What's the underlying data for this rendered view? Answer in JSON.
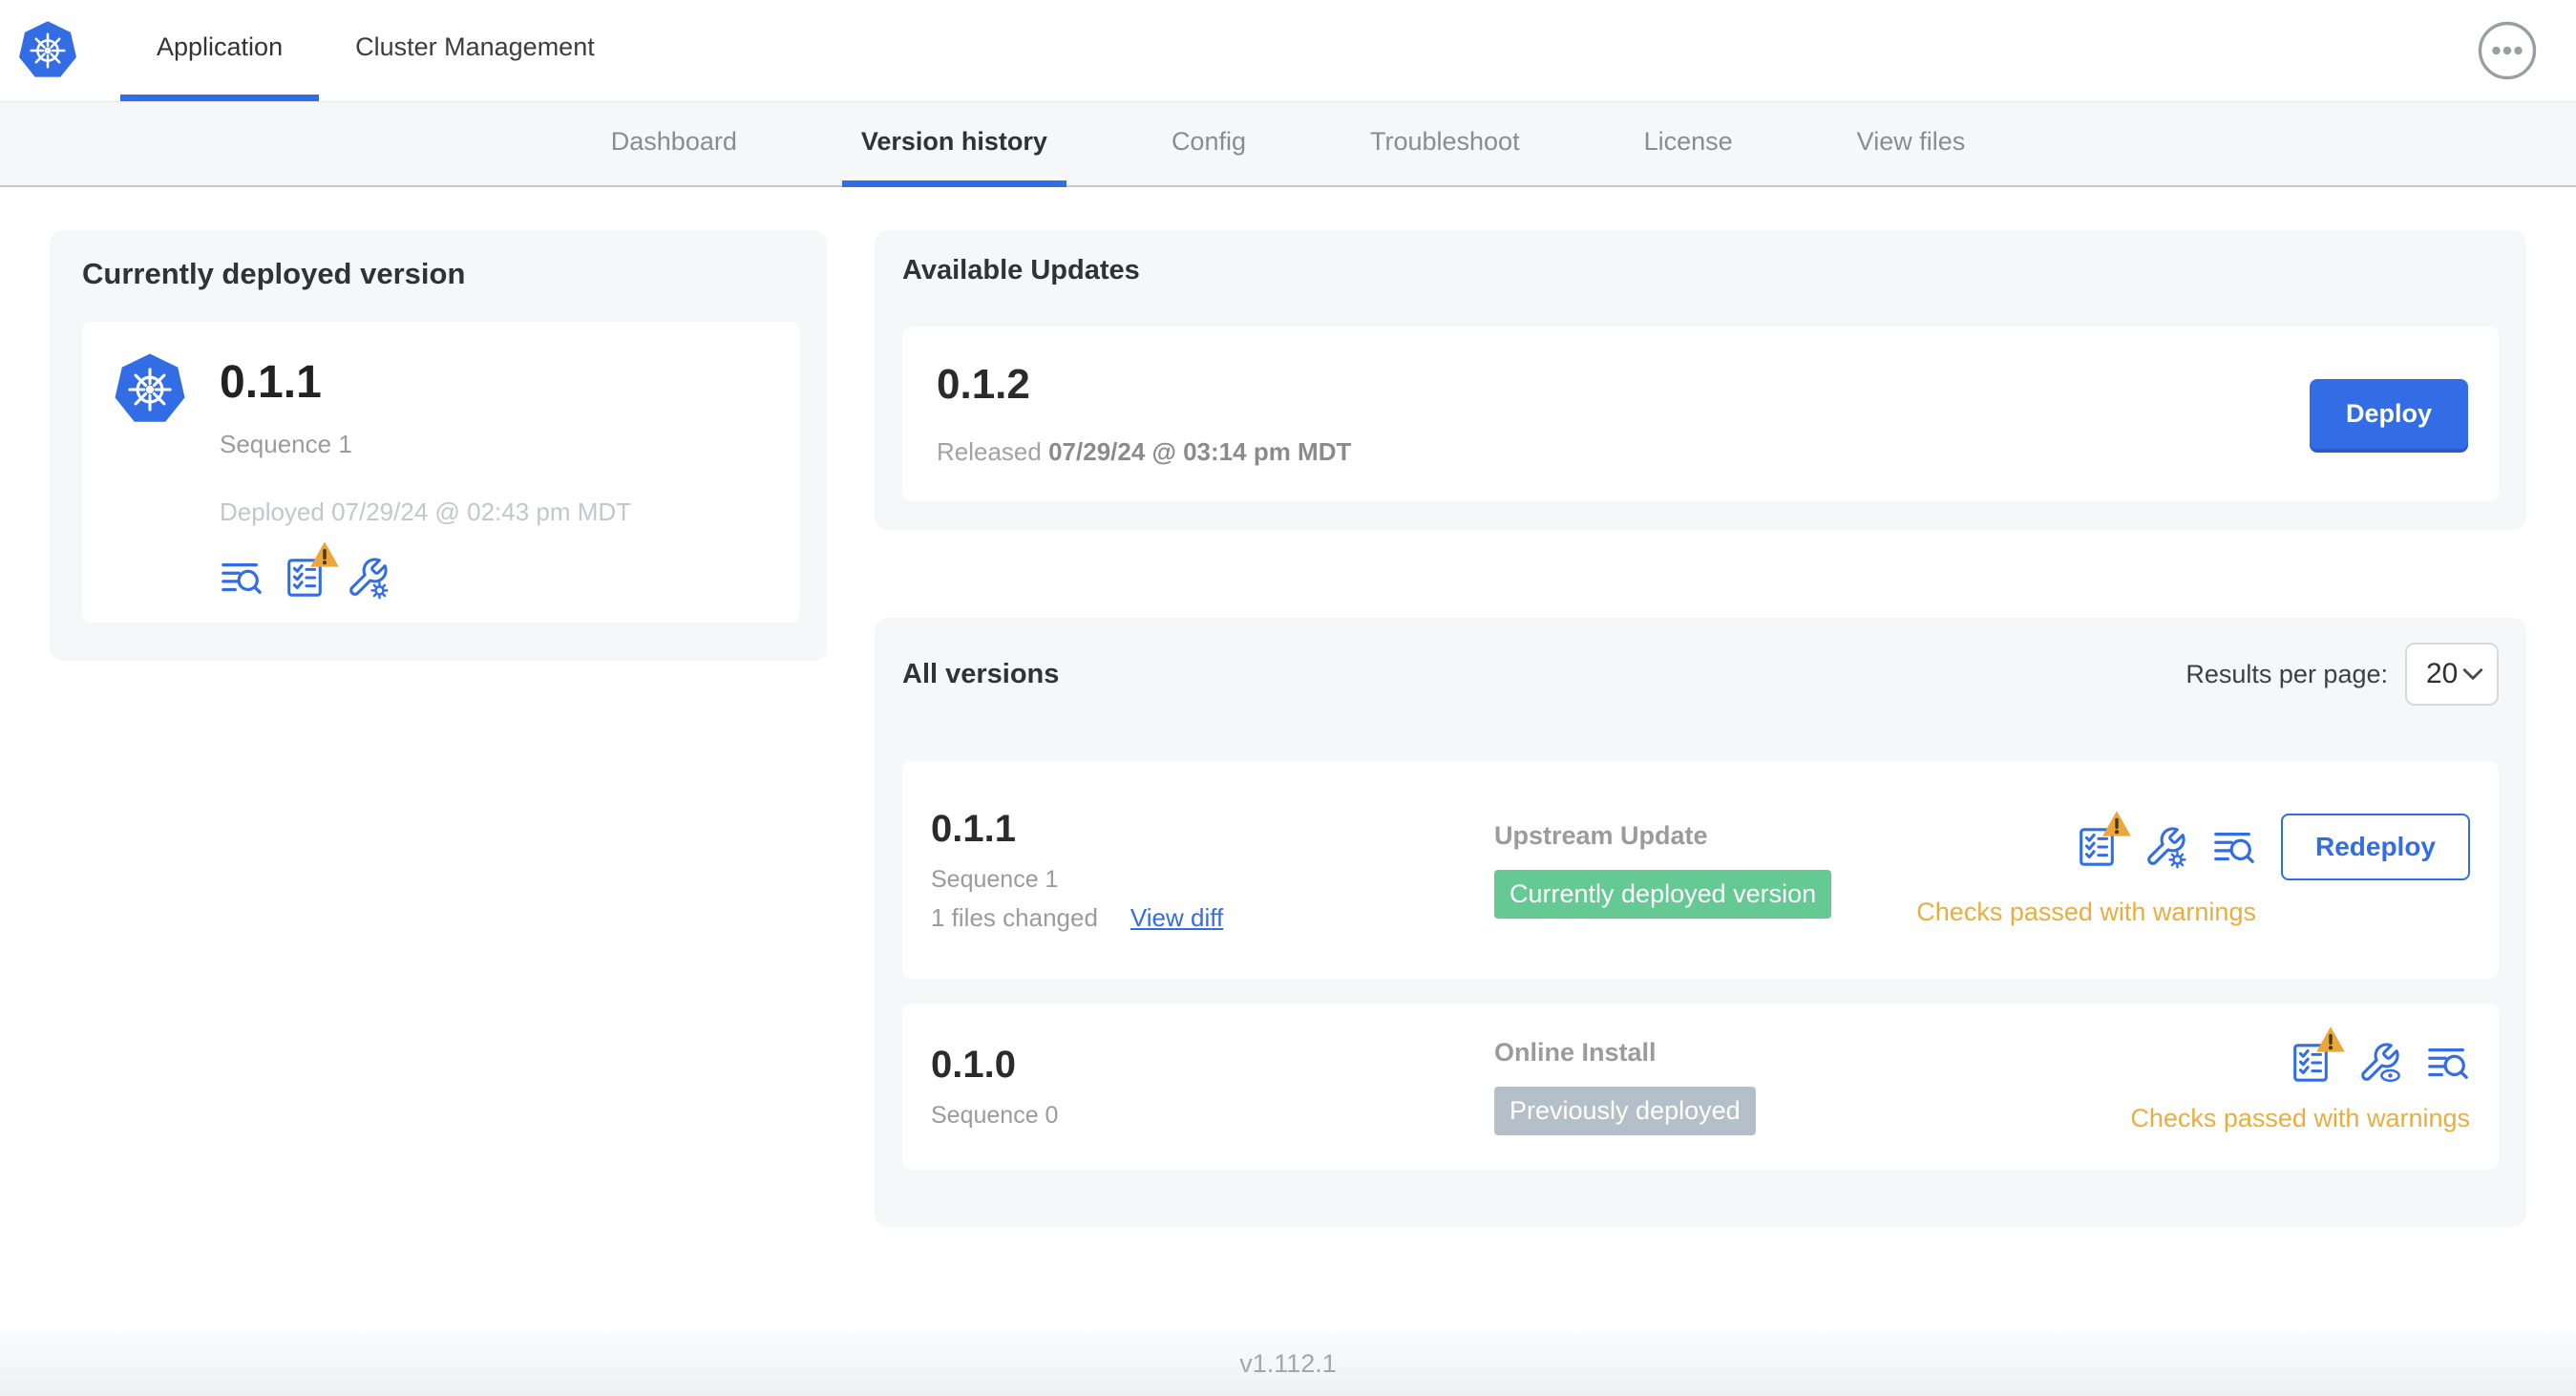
{
  "header": {
    "logo_icon": "kubernetes-logo-icon",
    "tabs": [
      {
        "label": "Application",
        "active": true
      },
      {
        "label": "Cluster Management",
        "active": false
      }
    ],
    "menu_icon": "ellipsis-icon"
  },
  "subnav": {
    "tabs": [
      {
        "label": "Dashboard",
        "active": false
      },
      {
        "label": "Version history",
        "active": true
      },
      {
        "label": "Config",
        "active": false
      },
      {
        "label": "Troubleshoot",
        "active": false
      },
      {
        "label": "License",
        "active": false
      },
      {
        "label": "View files",
        "active": false
      }
    ]
  },
  "deployed_card": {
    "title": "Currently deployed version",
    "version": "0.1.1",
    "sequence": "Sequence 1",
    "deployed_at": "Deployed 07/29/24 @ 02:43 pm MDT",
    "icons": [
      "logs-search-icon",
      "preflight-checks-warning-icon",
      "edit-config-icon"
    ]
  },
  "available_updates": {
    "title": "Available Updates",
    "version": "0.1.2",
    "released_prefix": "Released",
    "released_at": "07/29/24 @ 03:14 pm MDT",
    "deploy_label": "Deploy"
  },
  "all_versions": {
    "title": "All versions",
    "results_per_page_label": "Results per page:",
    "results_per_page_value": "20",
    "rows": [
      {
        "version": "0.1.1",
        "sequence": "Sequence 1",
        "files_changed": "1 files changed",
        "view_diff_label": "View diff",
        "source": "Upstream Update",
        "badge": "Currently deployed version",
        "badge_color": "#65c994",
        "icons": [
          "preflight-checks-warning-icon",
          "edit-config-icon",
          "logs-search-icon"
        ],
        "checks": "Checks passed with warnings",
        "action_label": "Redeploy"
      },
      {
        "version": "0.1.0",
        "sequence": "Sequence 0",
        "source": "Online Install",
        "badge": "Previously deployed",
        "badge_color": "#b5bfc9",
        "icons": [
          "preflight-checks-warning-icon",
          "view-config-icon",
          "logs-search-icon"
        ],
        "checks": "Checks passed with warnings"
      }
    ]
  },
  "footer": {
    "version": "v1.112.1"
  },
  "colors": {
    "accent": "#326de6",
    "warning_triangle": "#eba73c",
    "warning_text": "#e9ad40",
    "badge_green": "#65c994",
    "badge_gray": "#b5bfc9",
    "panel_bg": "#f6f7f9"
  }
}
